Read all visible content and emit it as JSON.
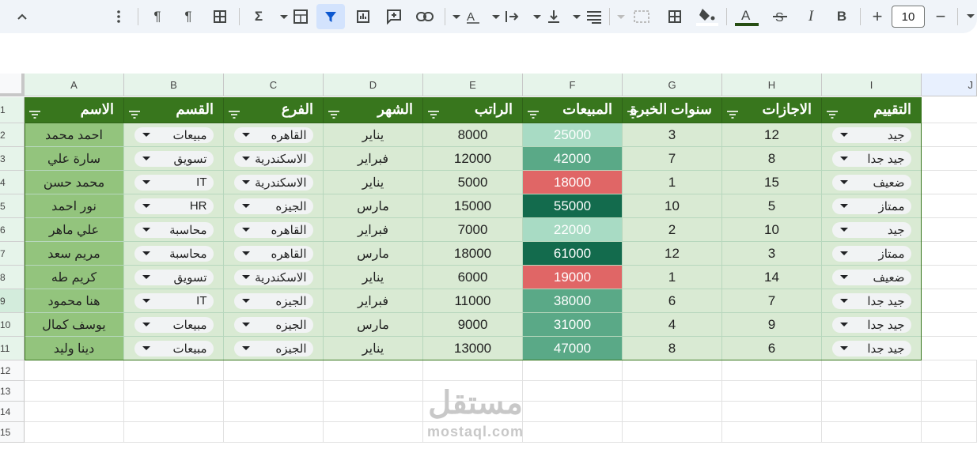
{
  "toolbar": {
    "font_size": "10",
    "icons": [
      "chevron-up-icon",
      "more-vert-icon",
      "rtl-text-icon",
      "ltr-text-icon",
      "table-icon",
      "sigma-icon",
      "calculator-icon",
      "filter-icon",
      "chart-icon",
      "comment-add-icon",
      "link-icon",
      "text-direction-icon",
      "indent-icon",
      "valign-icon",
      "halign-icon",
      "merge-icon",
      "borders-icon",
      "fill-color-icon",
      "text-color-icon",
      "strikethrough-icon",
      "italic-icon",
      "bold-icon",
      "plus-icon",
      "minus-icon",
      "chevron-down-icon"
    ]
  },
  "columns": [
    "A",
    "B",
    "C",
    "D",
    "E",
    "F",
    "G",
    "H",
    "I",
    "J"
  ],
  "row_numbers": [
    "1",
    "2",
    "3",
    "4",
    "5",
    "6",
    "7",
    "8",
    "9",
    "10",
    "11",
    "12",
    "13",
    "14",
    "15"
  ],
  "header": {
    "name": "الاسم",
    "dept": "القسم",
    "branch": "الفرع",
    "month": "الشهر",
    "salary": "الراتب",
    "sales": "المبيعات",
    "years": "سنوات الخبرة",
    "leaves": "الاجازات",
    "rating": "التقييم"
  },
  "rows": [
    {
      "name": "احمد محمد",
      "dept": "مبيعات",
      "branch": "القاهره",
      "month": "يناير",
      "salary": "8000",
      "sales": "25000",
      "years": "3",
      "leaves": "12",
      "rating": "جيد"
    },
    {
      "name": "سارة علي",
      "dept": "تسويق",
      "branch": "الاسكندرية",
      "month": "فبراير",
      "salary": "12000",
      "sales": "42000",
      "years": "7",
      "leaves": "8",
      "rating": "جيد جدا"
    },
    {
      "name": "محمد حسن",
      "dept": "IT",
      "branch": "الاسكندرية",
      "month": "يناير",
      "salary": "5000",
      "sales": "18000",
      "years": "1",
      "leaves": "15",
      "rating": "ضعيف"
    },
    {
      "name": "نور احمد",
      "dept": "HR",
      "branch": "الجيزه",
      "month": "مارس",
      "salary": "15000",
      "sales": "55000",
      "years": "10",
      "leaves": "5",
      "rating": "ممتاز"
    },
    {
      "name": "علي ماهر",
      "dept": "محاسبة",
      "branch": "القاهره",
      "month": "فبراير",
      "salary": "7000",
      "sales": "22000",
      "years": "2",
      "leaves": "10",
      "rating": "جيد"
    },
    {
      "name": "مريم سعد",
      "dept": "محاسبة",
      "branch": "القاهره",
      "month": "مارس",
      "salary": "18000",
      "sales": "61000",
      "years": "12",
      "leaves": "3",
      "rating": "ممتاز"
    },
    {
      "name": "كريم طه",
      "dept": "تسويق",
      "branch": "الاسكندرية",
      "month": "يناير",
      "salary": "6000",
      "sales": "19000",
      "years": "1",
      "leaves": "14",
      "rating": "ضعيف"
    },
    {
      "name": "هنا محمود",
      "dept": "IT",
      "branch": "الجيزه",
      "month": "فبراير",
      "salary": "11000",
      "sales": "38000",
      "years": "6",
      "leaves": "7",
      "rating": "جيد جدا"
    },
    {
      "name": "يوسف كمال",
      "dept": "مبيعات",
      "branch": "الجيزه",
      "month": "مارس",
      "salary": "9000",
      "sales": "31000",
      "years": "4",
      "leaves": "9",
      "rating": "جيد جدا"
    },
    {
      "name": "دينا وليد",
      "dept": "مبيعات",
      "branch": "الجيزه",
      "month": "يناير",
      "salary": "13000",
      "sales": "47000",
      "years": "8",
      "leaves": "6",
      "rating": "جيد جدا"
    }
  ],
  "sales_colors": [
    "#a8dbc4",
    "#5aa987",
    "#e06666",
    "#136b4d",
    "#a8dbc4",
    "#136b4d",
    "#e06666",
    "#5aa987",
    "#5aa987",
    "#5aa987"
  ],
  "watermark": {
    "arabic": "مستقل",
    "latin": "mostaql.com"
  }
}
